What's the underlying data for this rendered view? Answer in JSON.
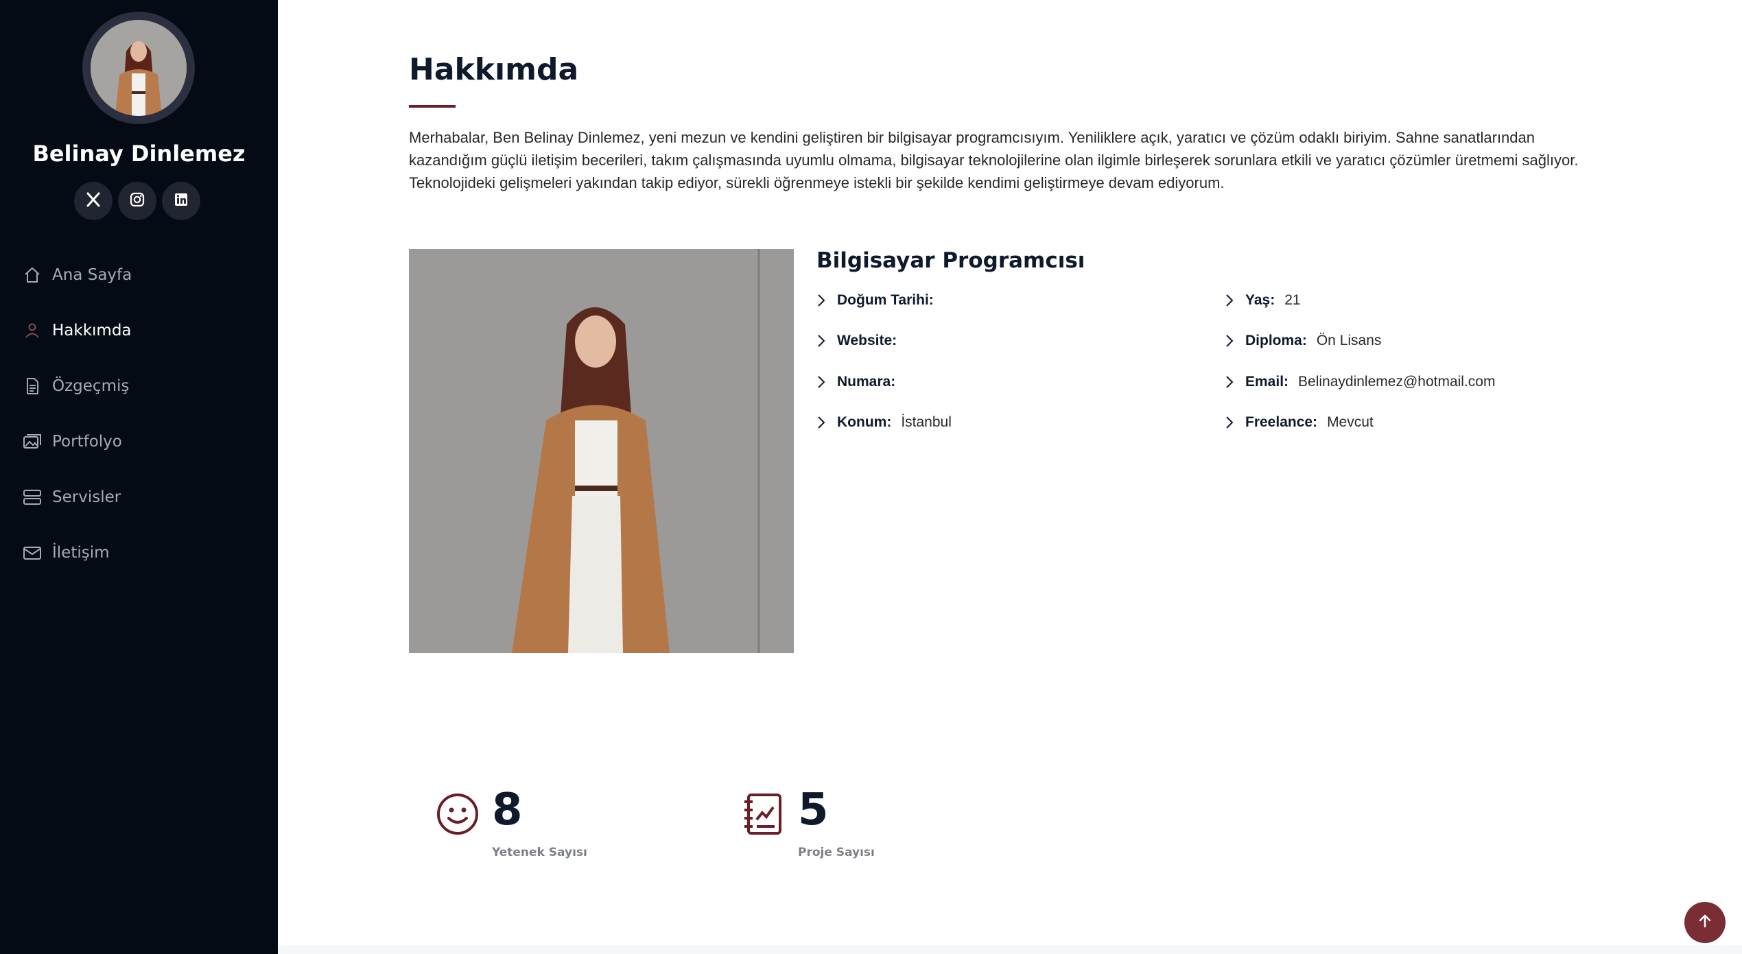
{
  "sidebar": {
    "name": "Belinay Dinlemez",
    "social": [
      {
        "icon": "x-twitter-icon"
      },
      {
        "icon": "instagram-icon"
      },
      {
        "icon": "linkedin-icon"
      }
    ],
    "nav": [
      {
        "label": "Ana Sayfa",
        "icon": "home-icon",
        "active": false
      },
      {
        "label": "Hakkımda",
        "icon": "person-icon",
        "active": true
      },
      {
        "label": "Özgeçmiş",
        "icon": "file-text-icon",
        "active": false
      },
      {
        "label": "Portfolyo",
        "icon": "images-icon",
        "active": false
      },
      {
        "label": "Servisler",
        "icon": "server-icon",
        "active": false
      },
      {
        "label": "İletişim",
        "icon": "envelope-icon",
        "active": false
      }
    ]
  },
  "about": {
    "title": "Hakkımda",
    "text": "Merhabalar, Ben Belinay Dinlemez, yeni mezun ve kendini geliştiren bir bilgisayar programcısıyım. Yeniliklere açık, yaratıcı ve çözüm odaklı biriyim. Sahne sanatlarından kazandığım güçlü iletişim becerileri, takım çalışmasında uyumlu olmama, bilgisayar teknolojilerine olan ilgimle birleşerek sorunlara etkili ve yaratıcı çözümler üretmemi sağlıyor. Teknolojideki gelişmeleri yakından takip ediyor, sürekli öğrenmeye istekli bir şekilde kendimi geliştirmeye devam ediyorum.",
    "role": "Bilgisayar Programcısı",
    "info_left": [
      {
        "label": "Doğum Tarihi:",
        "value": ""
      },
      {
        "label": "Website:",
        "value": ""
      },
      {
        "label": "Numara:",
        "value": ""
      },
      {
        "label": "Konum:",
        "value": "İstanbul"
      }
    ],
    "info_right": [
      {
        "label": "Yaş:",
        "value": "21"
      },
      {
        "label": "Diploma:",
        "value": "Ön Lisans"
      },
      {
        "label": "Email:",
        "value": "Belinaydinlemez@hotmail.com"
      },
      {
        "label": "Freelance:",
        "value": "Mevcut"
      }
    ]
  },
  "counters": [
    {
      "value": "8",
      "label": "Yetenek Sayısı",
      "icon": "smiley-icon"
    },
    {
      "value": "5",
      "label": "Proje Sayısı",
      "icon": "journal-icon"
    }
  ],
  "colors": {
    "sidebar_bg": "#040b14",
    "accent": "#6a1e28",
    "back_to_top": "#7a2d34"
  }
}
